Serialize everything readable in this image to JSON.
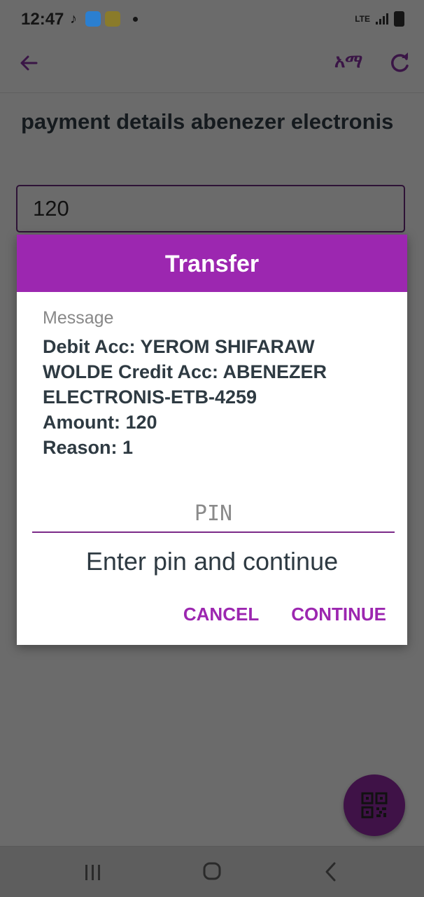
{
  "status_bar": {
    "time": "12:47",
    "network": "LTE"
  },
  "toolbar": {
    "language_label": "አማ"
  },
  "page": {
    "title": "payment details abenezer electronis",
    "amount_value": "120"
  },
  "dialog": {
    "title": "Transfer",
    "message_label": "Message",
    "message_lines": [
      "Debit Acc: YEROM SHIFARAW",
      "WOLDE Credit Acc: ABENEZER",
      "ELECTRONIS-ETB-4259",
      "Amount: 120",
      "Reason: 1"
    ],
    "pin_placeholder": "PIN",
    "pin_hint": "Enter pin and continue",
    "cancel_label": "CANCEL",
    "continue_label": "CONTINUE"
  },
  "colors": {
    "accent": "#9c27b0",
    "fab": "#3f1247",
    "overlay": "#6b6b6b"
  },
  "icons": [
    "back-arrow-icon",
    "refresh-icon",
    "qr-code-icon",
    "recent-apps-icon",
    "home-icon",
    "nav-back-icon"
  ]
}
